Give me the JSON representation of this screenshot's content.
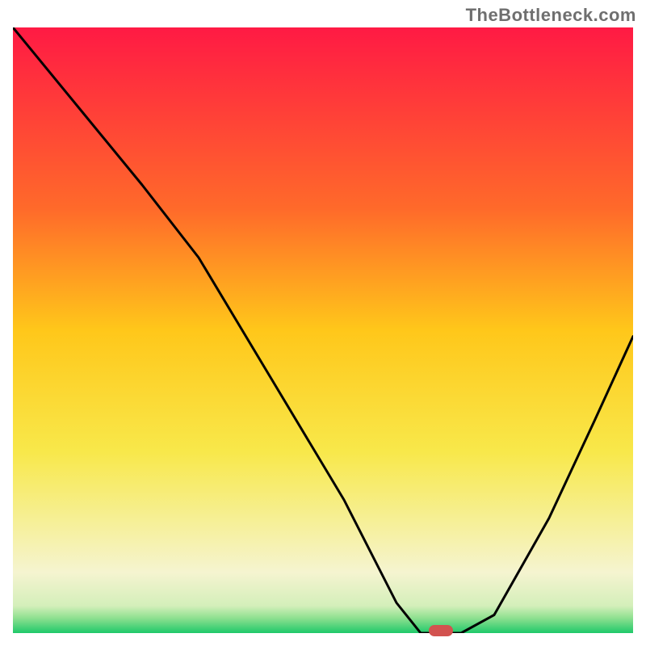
{
  "watermark": "TheBottleneck.com",
  "chart_data": {
    "type": "line",
    "title": "",
    "xlabel": "",
    "ylabel": "",
    "x_range": [
      0,
      768
    ],
    "y_range_percent": [
      0,
      100
    ],
    "gradient_stops": [
      {
        "offset": 0.0,
        "color": "#ff1a44"
      },
      {
        "offset": 0.3,
        "color": "#ff6a2a"
      },
      {
        "offset": 0.5,
        "color": "#ffc71a"
      },
      {
        "offset": 0.7,
        "color": "#f8e84a"
      },
      {
        "offset": 0.82,
        "color": "#f6f09a"
      },
      {
        "offset": 0.9,
        "color": "#f5f4d0"
      },
      {
        "offset": 0.955,
        "color": "#d4efba"
      },
      {
        "offset": 0.975,
        "color": "#8fe090"
      },
      {
        "offset": 1.0,
        "color": "#1fc96a"
      }
    ],
    "series": [
      {
        "name": "bottleneck-curve",
        "points": [
          {
            "x": 0,
            "bottleneck_pct": 100
          },
          {
            "x": 80,
            "bottleneck_pct": 87
          },
          {
            "x": 160,
            "bottleneck_pct": 74
          },
          {
            "x": 230,
            "bottleneck_pct": 62
          },
          {
            "x": 320,
            "bottleneck_pct": 42
          },
          {
            "x": 410,
            "bottleneck_pct": 22
          },
          {
            "x": 475,
            "bottleneck_pct": 5
          },
          {
            "x": 505,
            "bottleneck_pct": 0
          },
          {
            "x": 555,
            "bottleneck_pct": 0
          },
          {
            "x": 596,
            "bottleneck_pct": 3
          },
          {
            "x": 664,
            "bottleneck_pct": 19
          },
          {
            "x": 720,
            "bottleneck_pct": 35
          },
          {
            "x": 768,
            "bottleneck_pct": 49
          }
        ]
      }
    ],
    "marker": {
      "x": 530,
      "bottleneck_pct": 0,
      "color": "#d2524f"
    }
  }
}
